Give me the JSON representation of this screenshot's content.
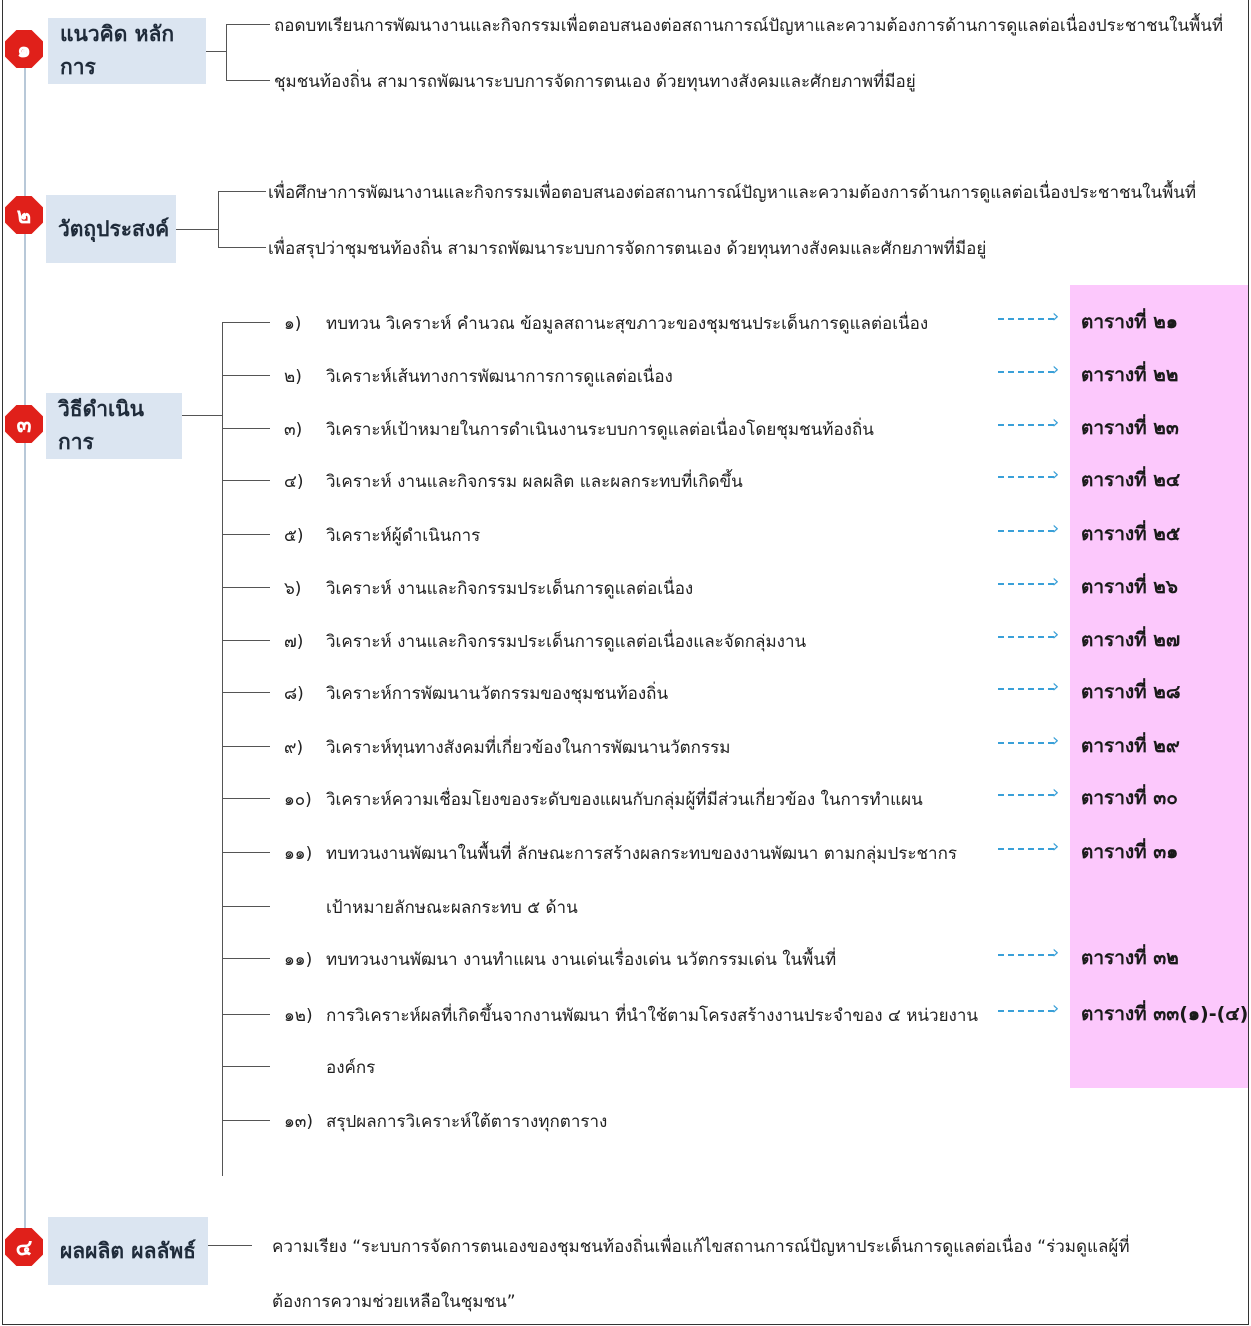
{
  "sections": [
    {
      "badge": "๑",
      "label": "แนวคิด หลักการ",
      "lines": [
        "ถอดบทเรียนการพัฒนางานและกิจกรรมเพื่อตอบสนองต่อสถานการณ์ปัญหาและความต้องการด้านการดูแลต่อเนื่องประชาชนในพื้นที่",
        "ชุมชนท้องถิ่น สามารถพัฒนาระบบการจัดการตนเอง ด้วยทุนทางสังคมและศักยภาพที่มีอยู่"
      ]
    },
    {
      "badge": "๒",
      "label": "วัตถุประสงค์",
      "lines": [
        "เพื่อศึกษาการพัฒนางานและกิจกรรมเพื่อตอบสนองต่อสถานการณ์ปัญหาและความต้องการด้านการดูแลต่อเนื่องประชาชนในพื้นที่",
        "เพื่อสรุปว่าชุมชนท้องถิ่น สามารถพัฒนาระบบการจัดการตนเอง ด้วยทุนทางสังคมและศักยภาพที่มีอยู่"
      ]
    },
    {
      "badge": "๓",
      "label": "วิธีดำเนินการ"
    },
    {
      "badge": "๔",
      "label": "ผลผลิต ผลลัพธ์",
      "lines": [
        "ความเรียง “ระบบการจัดการตนเองของชุมชนท้องถิ่นเพื่อแก้ไขสถานการณ์ปัญหาประเด็นการดูแลต่อเนื่อง “ร่วมดูแลผู้ที่",
        "ต้องการความช่วยเหลือในชุมชน”"
      ]
    }
  ],
  "steps": [
    {
      "num": "๑)",
      "text": "ทบทวน วิเคราะห์ คำนวณ ข้อมูลสถานะสุขภาวะของชุมชนประเด็นการดูแลต่อเนื่อง",
      "table": "ตารางที่ ๒๑"
    },
    {
      "num": "๒)",
      "text": "วิเคราะห์เส้นทางการพัฒนาการการดูแลต่อเนื่อง",
      "table": "ตารางที่ ๒๒"
    },
    {
      "num": "๓)",
      "text": "วิเคราะห์เป้าหมายในการดำเนินงานระบบการดูแลต่อเนื่องโดยชุมชนท้องถิ่น",
      "table": "ตารางที่ ๒๓"
    },
    {
      "num": "๔)",
      "text": "วิเคราะห์ งานและกิจกรรม ผลผลิต และผลกระทบที่เกิดขึ้น",
      "table": "ตารางที่ ๒๔"
    },
    {
      "num": "๕)",
      "text": "วิเคราะห์ผู้ดำเนินการ",
      "table": "ตารางที่ ๒๕"
    },
    {
      "num": "๖)",
      "text": "วิเคราะห์ งานและกิจกรรมประเด็นการดูแลต่อเนื่อง",
      "table": "ตารางที่ ๒๖"
    },
    {
      "num": "๗)",
      "text": "วิเคราะห์ งานและกิจกรรมประเด็นการดูแลต่อเนื่องและจัดกลุ่มงาน",
      "table": "ตารางที่ ๒๗"
    },
    {
      "num": "๘)",
      "text": "วิเคราะห์การพัฒนานวัตกรรมของชุมชนท้องถิ่น",
      "table": "ตารางที่ ๒๘"
    },
    {
      "num": "๙)",
      "text": "วิเคราะห์ทุนทางสังคมที่เกี่ยวข้องในการพัฒนานวัตกรรม",
      "table": "ตารางที่ ๒๙"
    },
    {
      "num": "๑๐)",
      "text": "วิเคราะห์ความเชื่อมโยงของระดับของแผนกับกลุ่มผู้ที่มีส่วนเกี่ยวข้อง ในการทำแผน",
      "table": "ตารางที่ ๓๐"
    },
    {
      "num": "๑๑)",
      "text": "ทบทวนงานพัฒนาในพื้นที่ ลักษณะการสร้างผลกระทบของงานพัฒนา ตามกลุ่มประชากร",
      "table": "ตารางที่ ๓๑"
    },
    {
      "num": "",
      "text": "เป้าหมายลักษณะผลกระทบ ๕ ด้าน",
      "table": ""
    },
    {
      "num": "๑๑)",
      "text": "ทบทวนงานพัฒนา งานทำแผน งานเด่นเรื่องเด่น นวัตกรรมเด่น ในพื้นที่",
      "table": "ตารางที่ ๓๒"
    },
    {
      "num": "๑๒)",
      "text": "การวิเคราะห์ผลที่เกิดขึ้นจากงานพัฒนา ที่นำใช้ตามโครงสร้างงานประจำของ ๔ หน่วยงาน",
      "table": "ตารางที่ ๓๓(๑)-(๔)"
    },
    {
      "num": "",
      "text": "องค์กร",
      "table": ""
    },
    {
      "num": "๑๓)",
      "text": "สรุปผลการวิเคราะห์ใต้ตารางทุกตาราง",
      "table": ""
    }
  ],
  "colors": {
    "badge": "#e0201a",
    "label_bg": "#dbe5f1",
    "table_bg": "#fcc8fc",
    "arrow": "#3aa0d8"
  }
}
